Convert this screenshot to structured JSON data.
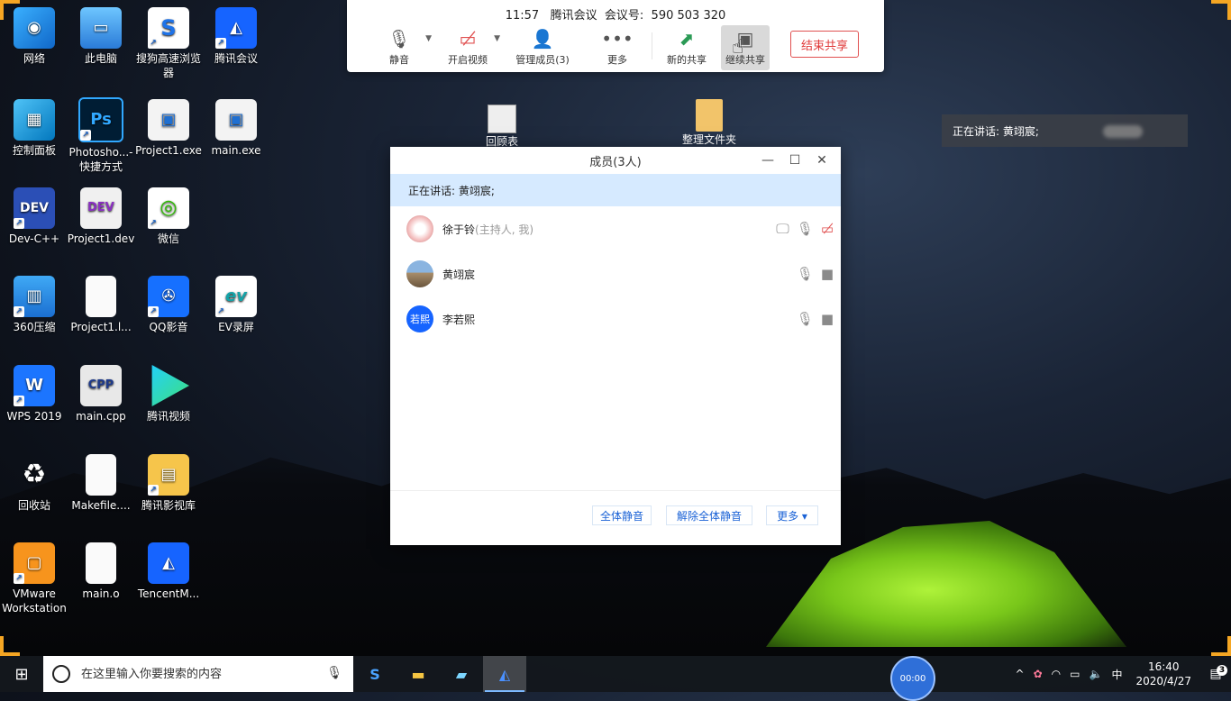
{
  "desktop": {
    "icons": [
      {
        "label": "网络",
        "glyph": "◉"
      },
      {
        "label": "此电脑",
        "glyph": "▭"
      },
      {
        "label": "搜狗高速浏览器",
        "glyph": "S"
      },
      {
        "label": "腾讯会议",
        "glyph": "◭"
      },
      {
        "label": "控制面板",
        "glyph": "▦"
      },
      {
        "label": "Photosho...- 快捷方式",
        "glyph": "Ps"
      },
      {
        "label": "Project1.exe",
        "glyph": "▣"
      },
      {
        "label": "main.exe",
        "glyph": "▣"
      },
      {
        "label": "Dev-C++",
        "glyph": "DEV"
      },
      {
        "label": "Project1.dev",
        "glyph": "DEV"
      },
      {
        "label": "微信",
        "glyph": "◎"
      },
      {
        "label": "360压缩",
        "glyph": "▥"
      },
      {
        "label": "Project1.l...",
        "glyph": ""
      },
      {
        "label": "QQ影音",
        "glyph": "✇"
      },
      {
        "label": "EV录屏",
        "glyph": "ev"
      },
      {
        "label": "WPS 2019",
        "glyph": "W"
      },
      {
        "label": "main.cpp",
        "glyph": "CPP"
      },
      {
        "label": "腾讯视频",
        "glyph": ""
      },
      {
        "label": "回收站",
        "glyph": "♻"
      },
      {
        "label": "Makefile....",
        "glyph": ""
      },
      {
        "label": "腾讯影视库",
        "glyph": "▤"
      },
      {
        "label": "VMware Workstation",
        "glyph": "▢"
      },
      {
        "label": "main.o",
        "glyph": ""
      },
      {
        "label": "TencentM...",
        "glyph": "◭"
      }
    ],
    "behind_items": [
      {
        "label": "回顾表"
      },
      {
        "label": "整理文件夹"
      }
    ]
  },
  "meeting_bar": {
    "time": "11:57",
    "app_name": "腾讯会议",
    "meeting_id_label": "会议号:",
    "meeting_id": "590 503 320",
    "tools": {
      "mute": "静音",
      "video": "开启视频",
      "members": "管理成员(3)",
      "more": "更多",
      "new_share": "新的共享",
      "continue_share": "继续共享"
    },
    "end_share": "结束共享"
  },
  "speaking_float": {
    "text": "正在讲话: 黄翊宸;"
  },
  "members_window": {
    "title": "成员(3人)",
    "speaking": "正在讲话: 黄翊宸;",
    "members": [
      {
        "name": "徐于铃",
        "role": "(主持人, 我)",
        "avatar": ""
      },
      {
        "name": "黄翊宸",
        "role": "",
        "avatar": ""
      },
      {
        "name": "李若熙",
        "role": "",
        "avatar": "若熙"
      }
    ],
    "footer": {
      "mute_all": "全体静音",
      "unmute_all": "解除全体静音",
      "more": "更多 ▾"
    }
  },
  "taskbar": {
    "search_placeholder": "在这里输入你要搜索的内容",
    "timer": "00:00",
    "ime": "中",
    "time": "16:40",
    "date": "2020/4/27",
    "notifications": "3"
  }
}
